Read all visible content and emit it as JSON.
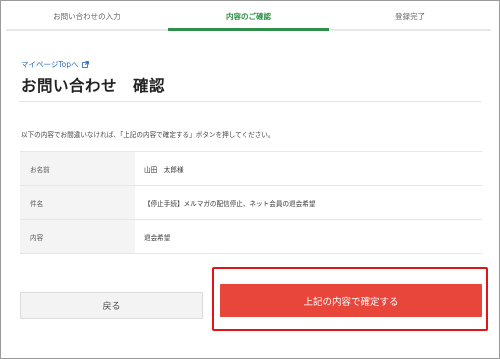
{
  "steps": [
    {
      "label": "お問い合わせの入力",
      "active": false
    },
    {
      "label": "内容のご確認",
      "active": true
    },
    {
      "label": "登録完了",
      "active": false
    }
  ],
  "mypage_link": "マイページTopへ",
  "title": "お問い合わせ　確認",
  "instruction": "以下の内容でお間違いなければ、「上記の内容で確定する」ボタンを押してください。",
  "rows": [
    {
      "label": "お名前",
      "value": "山田　太郎様"
    },
    {
      "label": "件名",
      "value": "【停止手続】メルマガの配信停止、ネット会員の退会希望"
    },
    {
      "label": "内容",
      "value": "退会希望"
    }
  ],
  "buttons": {
    "back": "戻る",
    "confirm": "上記の内容で確定する"
  },
  "colors": {
    "accent_green": "#2f8f4a",
    "confirm_red": "#e8453b",
    "highlight_red": "#e01515",
    "link_blue": "#2a6bb8"
  }
}
